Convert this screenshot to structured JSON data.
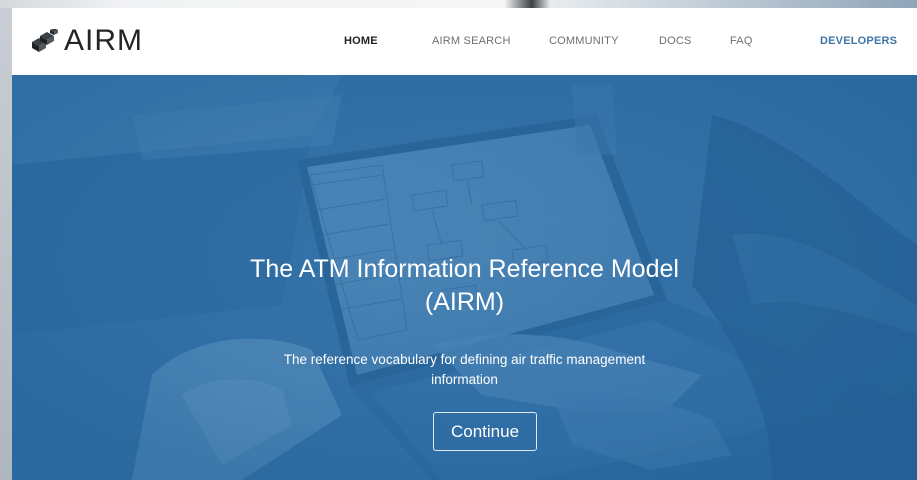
{
  "brand": {
    "logo_text": "AIRM",
    "logo_icon": "cubes-icon"
  },
  "nav": {
    "home": "HOME",
    "airm_search": "AIRM SEARCH",
    "community": "COMMUNITY",
    "docs": "DOCS",
    "faq": "FAQ",
    "developers": "DEVELOPERS"
  },
  "hero": {
    "title_line1": "The ATM Information Reference Model",
    "title_line2": "(AIRM)",
    "subtitle_line1": "The reference vocabulary for defining air traffic management",
    "subtitle_line2": "information",
    "cta_label": "Continue"
  },
  "colors": {
    "hero_blue": "#2f6aa0",
    "nav_active": "#1d2124",
    "nav_inactive": "#6c6f72",
    "nav_developers": "#3f76a8"
  }
}
